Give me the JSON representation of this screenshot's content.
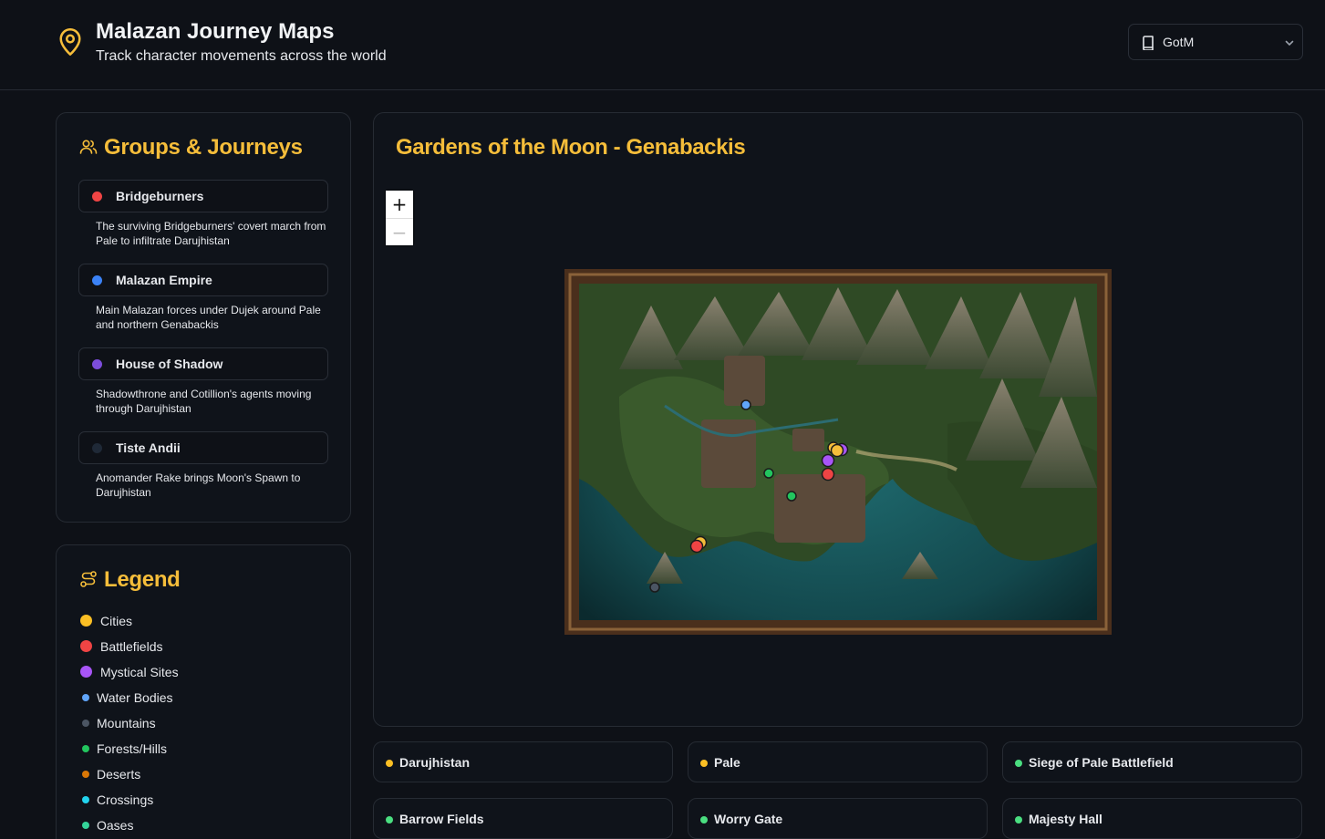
{
  "header": {
    "icon": "map-pin-icon",
    "title": "Malazan Journey Maps",
    "subtitle": "Track character movements across the world",
    "book_select": {
      "icon": "book-icon",
      "value": "GotM"
    }
  },
  "groups": {
    "icon": "users-icon",
    "title": "Groups & Journeys",
    "items": [
      {
        "name": "Bridgeburners",
        "color": "#ef4444",
        "description": "The surviving Bridgeburners' covert march from Pale to infiltrate Darujhistan"
      },
      {
        "name": "Malazan Empire",
        "color": "#3b82f6",
        "description": "Main Malazan forces under Dujek around Pale and northern Genabackis"
      },
      {
        "name": "House of Shadow",
        "color": "#7c4ddc",
        "description": "Shadowthrone and Cotillion's agents moving through Darujhistan"
      },
      {
        "name": "Tiste Andii",
        "color": "#1f2937",
        "description": "Anomander Rake brings Moon's Spawn to Darujhistan"
      }
    ]
  },
  "legend": {
    "icon": "route-icon",
    "title": "Legend",
    "items": [
      {
        "label": "Cities",
        "color": "#fbbf24",
        "size": "large"
      },
      {
        "label": "Battlefields",
        "color": "#ef4444",
        "size": "large"
      },
      {
        "label": "Mystical Sites",
        "color": "#a855f7",
        "size": "large"
      },
      {
        "label": "Water Bodies",
        "color": "#60a5fa",
        "size": "small"
      },
      {
        "label": "Mountains",
        "color": "#4b5563",
        "size": "small"
      },
      {
        "label": "Forests/Hills",
        "color": "#22c55e",
        "size": "small"
      },
      {
        "label": "Deserts",
        "color": "#d97706",
        "size": "small"
      },
      {
        "label": "Crossings",
        "color": "#22d3ee",
        "size": "small"
      },
      {
        "label": "Oases",
        "color": "#34d399",
        "size": "small"
      }
    ]
  },
  "map": {
    "title": "Gardens of the Moon - Genabackis",
    "zoom_in": "+",
    "zoom_out": "−"
  },
  "locations": [
    {
      "name": "Darujhistan",
      "color": "#fbbf24"
    },
    {
      "name": "Pale",
      "color": "#fbbf24"
    },
    {
      "name": "Siege of Pale Battlefield",
      "color": "#4ade80"
    },
    {
      "name": "Barrow Fields",
      "color": "#4ade80"
    },
    {
      "name": "Worry Gate",
      "color": "#4ade80"
    },
    {
      "name": "Majesty Hall",
      "color": "#4ade80"
    }
  ]
}
